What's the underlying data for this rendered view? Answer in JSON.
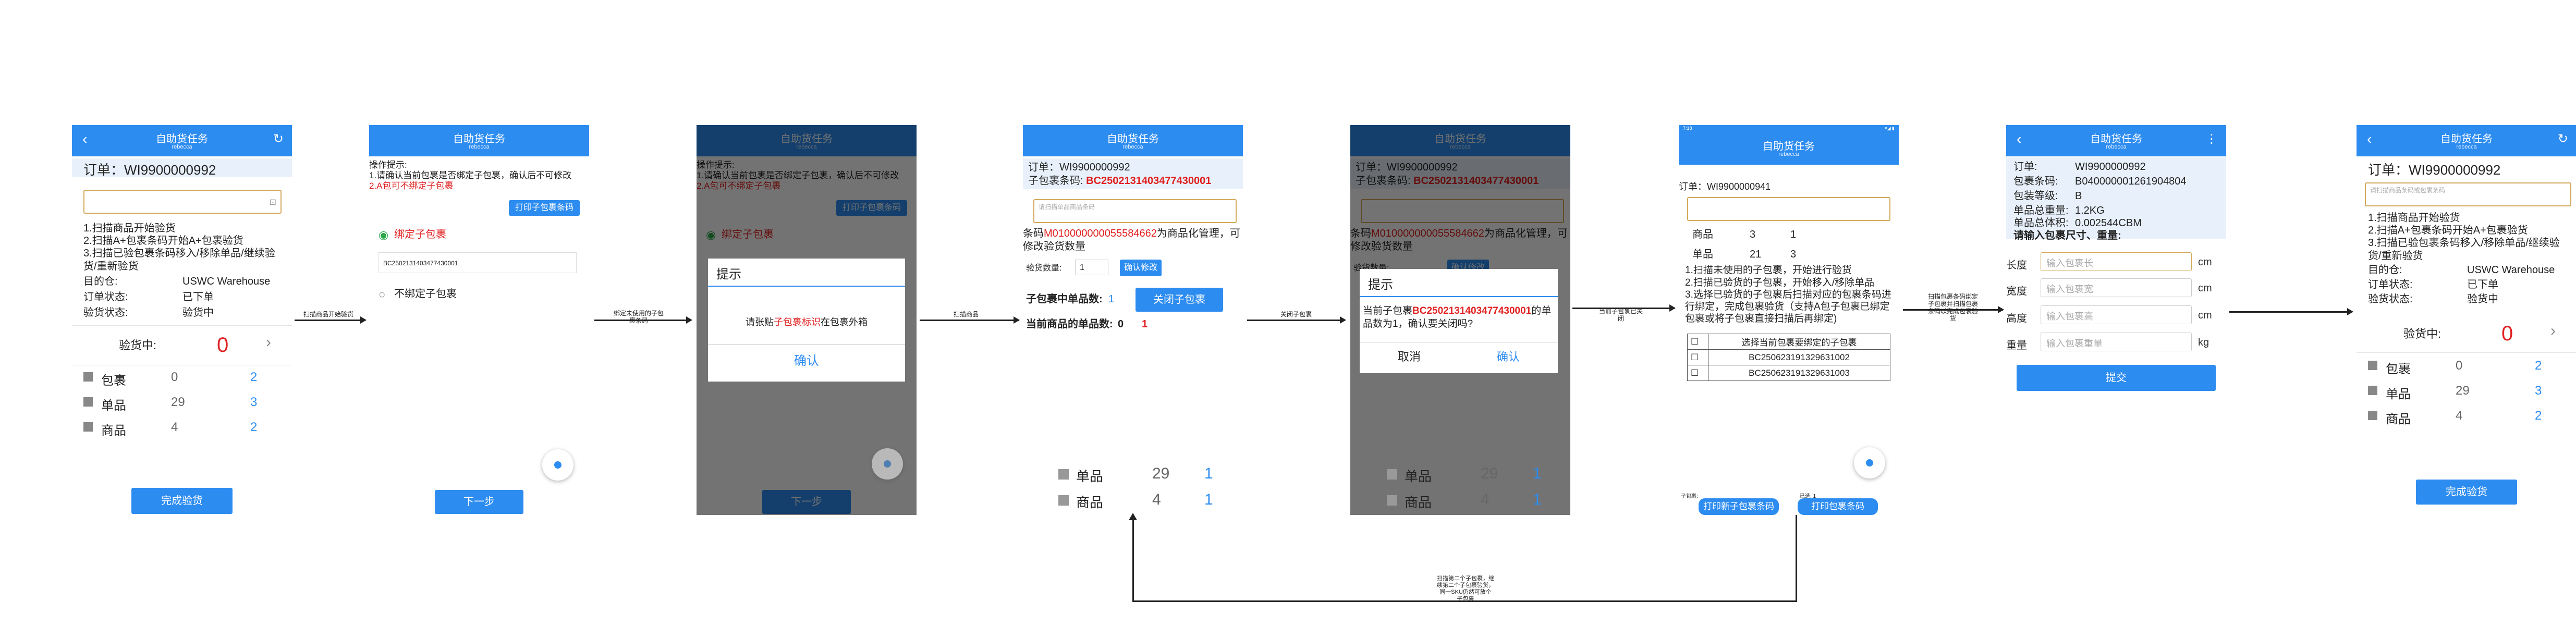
{
  "common": {
    "app_title": "自助货任务",
    "app_subtitle": "rebecca",
    "order_prefix": "订单：",
    "order_no": "WI9900000992",
    "order_no_2": "WI9900000941"
  },
  "screen1": {
    "instructions": [
      "1.扫描商品开始验货",
      "2.扫描A+包裹条码开始A+包裹验货",
      "3.扫描已验包裹条码移入/移除单品/继续验货/重新验货"
    ],
    "info": [
      {
        "label": "目的仓:",
        "value": "USWC Warehouse"
      },
      {
        "label": "订单状态:",
        "value": "已下单"
      },
      {
        "label": "验货状态:",
        "value": "验货中"
      }
    ],
    "checking_label": "验货中:",
    "checking_value": "0",
    "counts": [
      {
        "label": "包裹",
        "a": "0",
        "b": "2"
      },
      {
        "label": "单品",
        "a": "29",
        "b": "3"
      },
      {
        "label": "商品",
        "a": "4",
        "b": "2"
      }
    ],
    "finish_button": "完成验货"
  },
  "screen2": {
    "tip_title": "操作提示:",
    "tip_1": "1.请确认当前包裹是否绑定子包裹，确认后不可修改",
    "tip_2": "2.A包可不绑定子包裹",
    "print_button": "打印子包裹条码",
    "option_bind": "绑定子包裹",
    "barcode": "BC2502131403477430001",
    "option_unbind": "不绑定子包裹",
    "next_button": "下一步"
  },
  "screen3": {
    "dialog_title": "提示",
    "dialog_msg_pre": "请张贴",
    "dialog_msg_hl": "子包裹标识",
    "dialog_msg_post": "在包裹外箱",
    "confirm": "确认"
  },
  "screen4": {
    "sub_label": "子包裹条码:",
    "sub_code": "BC2502131403477430001",
    "scan_placeholder": "请扫描单品商品条码",
    "barcode_pre": "条码",
    "barcode_hl": "M010000000055584662",
    "barcode_post": "为商品化管理，可修改验货数量",
    "qty_label": "验货数量:",
    "qty_value": "1",
    "confirm_qty": "确认修改",
    "sub_count_label": "子包裹中单品数:",
    "sub_count_value": "1",
    "close_button": "关闭子包裹",
    "cur_count_label": "当前商品的单品数:",
    "cur_count_a": "0",
    "cur_count_b": "1"
  },
  "screen5": {
    "dialog_title": "提示",
    "msg_pre": "当前子包裹",
    "msg_hl": "BC2502131403477430001",
    "msg_post": "的单品数为1，确认要关闭吗?",
    "cancel": "取消",
    "confirm": "确认"
  },
  "screen6": {
    "statusbar_time": "7:18",
    "statusbar_right": "▾◢ ▮",
    "rows": [
      {
        "label": "商品",
        "a": "3",
        "b": "1"
      },
      {
        "label": "单品",
        "a": "21",
        "b": "3"
      }
    ],
    "instructions": [
      "1.扫描未使用的子包裹，开始进行验货",
      "2.扫描已验货的子包裹，开始移入/移除单品",
      "3.选择已验货的子包裹后扫描对应的包裹条码进行绑定，完成包裹验货（支持A包子包裹已绑定包裹或将子包裹直接扫描后再绑定)"
    ],
    "table_header": "选择当前包裹要绑定的子包裹",
    "table_rows": [
      "BC250623191329631002",
      "BC250623191329631003"
    ],
    "left_small": "子包裹:",
    "right_small": "已选: 1",
    "print_sub": "打印新子包裹条码",
    "print_pkg": "打印包裹条码"
  },
  "screen7": {
    "info": [
      {
        "label": "订单:",
        "value": "WI9900000992"
      },
      {
        "label": "包裹条码:",
        "value": "B040000001261904804"
      },
      {
        "label": "包装等级:",
        "value": "B"
      },
      {
        "label": "单品总重量:",
        "value": "1.2KG"
      },
      {
        "label": "单品总体积:",
        "value": "0.002544CBM"
      }
    ],
    "prompt": "请输入包裹尺寸、重量:",
    "fields": [
      {
        "label": "长度",
        "placeholder": "输入包裹长",
        "unit": "cm"
      },
      {
        "label": "宽度",
        "placeholder": "输入包裹宽",
        "unit": "cm"
      },
      {
        "label": "高度",
        "placeholder": "输入包裹高",
        "unit": "cm"
      },
      {
        "label": "重量",
        "placeholder": "输入包裹重量",
        "unit": "kg"
      }
    ],
    "submit": "提交"
  },
  "screen8": {
    "scan_placeholder": "请扫描商品条码或包裹条码",
    "checking_value": "0",
    "counts": [
      {
        "label": "包裹",
        "a": "0",
        "b": "2"
      },
      {
        "label": "单品",
        "a": "29",
        "b": "3"
      },
      {
        "label": "商品",
        "a": "4",
        "b": "2"
      }
    ],
    "finish_button": "完成验货"
  },
  "below4": {
    "counts": [
      {
        "label": "单品",
        "a": "29",
        "b": "1"
      },
      {
        "label": "商品",
        "a": "4",
        "b": "1"
      }
    ]
  },
  "below5": {
    "counts": [
      {
        "label": "单品",
        "a": "29",
        "b": "1"
      },
      {
        "label": "商品",
        "a": "4",
        "b": "1"
      }
    ]
  },
  "flow": {
    "a1": "扫描商品开始验货",
    "a2": "绑定未使用的子包裹条码",
    "a3": "扫描商品",
    "a4": "关闭子包裹",
    "a5": "当前子包裹已关闭",
    "a6": "扫描包裹条码绑定子包裹并扫描包裹条码以完成包裹验货",
    "loop": "扫描第二个子包裹，继续第二个子包裹验货，同一SKU仍然可放个子包裹"
  },
  "colors": {
    "primary": "#2d8cf0",
    "alert": "#e02020",
    "scan_border": "#d3a95a"
  }
}
